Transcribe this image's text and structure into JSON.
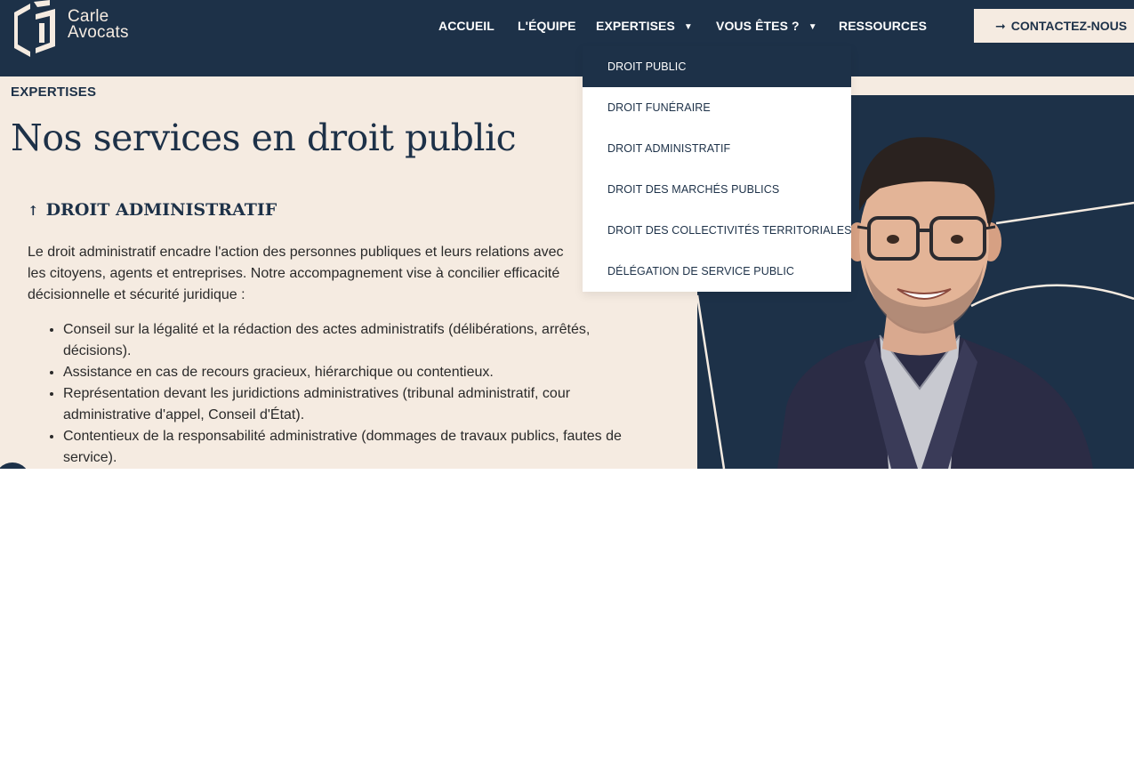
{
  "brand": {
    "line1": "Carle",
    "line2": "Avocats"
  },
  "nav": {
    "accueil": "ACCUEIL",
    "equipe": "L'ÉQUIPE",
    "expertises": "EXPERTISES",
    "vous_etes": "VOUS ÊTES ?",
    "ressources": "RESSOURCES",
    "cta": "CONTACTEZ-NOUS"
  },
  "dropdown": {
    "items": [
      "DROIT PUBLIC",
      "DROIT FUNÉRAIRE",
      "DROIT ADMINISTRATIF",
      "DROIT DES MARCHÉS PUBLICS",
      "DROIT DES COLLECTIVITÉS TERRITORIALES",
      "DÉLÉGATION DE SERVICE PUBLIC"
    ],
    "active_index": 0
  },
  "page": {
    "eyebrow": "EXPERTISES",
    "title": "Nos services en droit public",
    "section_title": "DROIT ADMINISTRATIF",
    "intro": "Le droit administratif encadre l'action des personnes publiques et leurs relations avec les citoyens, agents et entreprises. Notre accompagnement vise à concilier efficacité décisionnelle et sécurité juridique :",
    "bullets": [
      "Conseil sur la légalité et la rédaction des actes administratifs (délibérations, arrêtés, décisions).",
      "Assistance en cas de recours gracieux, hiérarchique ou contentieux.",
      "Représentation devant les juridictions administratives (tribunal administratif, cour administrative d'appel, Conseil d'État).",
      "Contentieux de la responsabilité administrative (dommages de travaux publics, fautes de service)."
    ]
  },
  "colors": {
    "navy": "#1d3148",
    "cream": "#f5ebe1",
    "text": "#2a2a2a"
  },
  "icons": {
    "logo": "carle-logo-mark",
    "caret": "caret-down-icon",
    "cta_arrow": "arrow-right-icon",
    "section_arrow": "arrow-up-icon",
    "chat": "chat-icon"
  }
}
